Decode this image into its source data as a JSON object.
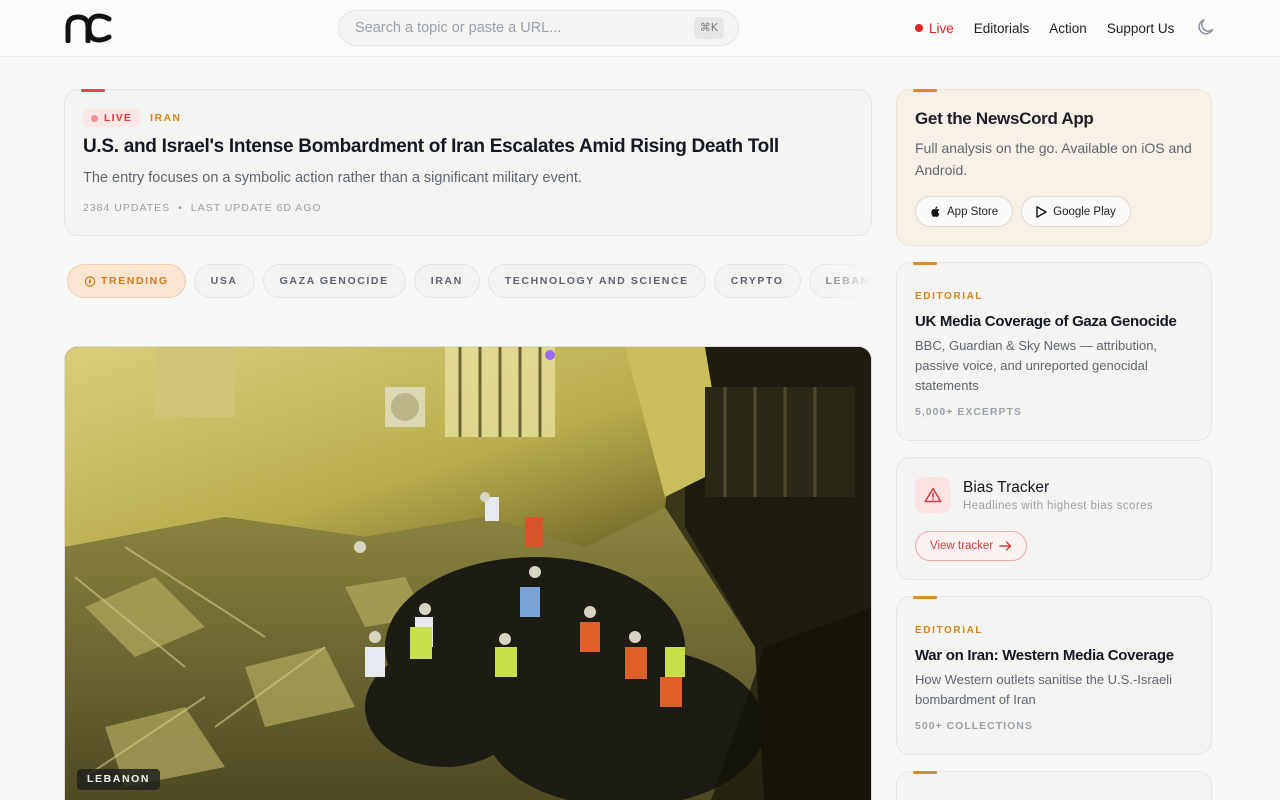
{
  "header": {
    "search_placeholder": "Search a topic or paste a URL...",
    "search_shortcut": "⌘K",
    "nav": {
      "live": "Live",
      "editorials": "Editorials",
      "action": "Action",
      "support": "Support Us"
    }
  },
  "live_story": {
    "badge": "LIVE",
    "category": "IRAN",
    "title": "U.S. and Israel's Intense Bombardment of Iran Escalates Amid Rising Death Toll",
    "subtitle": "The entry focuses on a symbolic action rather than a significant military event.",
    "updates": "2384 UPDATES",
    "separator": "•",
    "last_update": "LAST UPDATE 6D AGO"
  },
  "topics": {
    "trending": "TRENDING",
    "items": [
      "USA",
      "GAZA GENOCIDE",
      "IRAN",
      "TECHNOLOGY AND SCIENCE",
      "CRYPTO",
      "LEBANON"
    ]
  },
  "hero": {
    "tag": "LEBANON"
  },
  "sidebar": {
    "app": {
      "title": "Get the NewsCord App",
      "description": "Full analysis on the go. Available on iOS and Android.",
      "app_store": "App Store",
      "google_play": "Google Play"
    },
    "editorial_1": {
      "label": "EDITORIAL",
      "title": "UK Media Coverage of Gaza Genocide",
      "description": "BBC, Guardian & Sky News — attribution, passive voice, and unreported genocidal statements",
      "count": "5,000+ EXCERPTS"
    },
    "bias_tracker": {
      "title": "Bias Tracker",
      "subtitle": "Headlines with highest bias scores",
      "button": "View tracker"
    },
    "editorial_2": {
      "label": "EDITORIAL",
      "title": "War on Iran: Western Media Coverage",
      "description": "How Western outlets sanitise the U.S.-Israeli bombardment of Iran",
      "count": "500+ COLLECTIONS"
    }
  },
  "colors": {
    "live_red": "#e02424",
    "accent_orange": "#d6841a",
    "trending_bg": "#f8e5d2"
  }
}
